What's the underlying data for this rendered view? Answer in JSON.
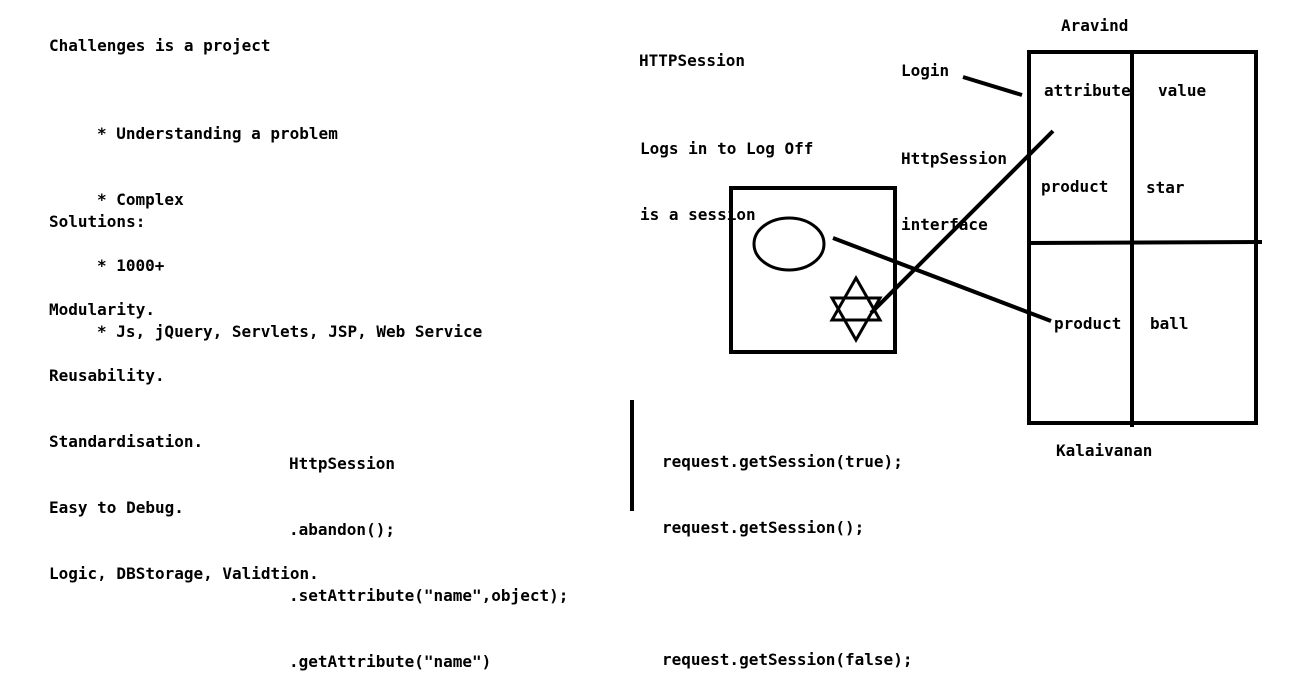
{
  "challenges": {
    "title": "Challenges is a project",
    "bullets": [
      "* Understanding a problem",
      "* Complex",
      "* 1000+",
      "* Js, jQuery, Servlets, JSP, Web Service"
    ]
  },
  "solutions": {
    "title": "Solutions:",
    "items": [
      "Modularity.",
      "Reusability.",
      "Standardisation.",
      "Easy to Debug.",
      "Logic, DBStorage, Validtion."
    ]
  },
  "http_session_heading": "HTTPSession",
  "session_note": [
    "Logs in to Log Off",
    "is a session"
  ],
  "login_label": "Login",
  "interface_label": [
    "HttpSession",
    "interface"
  ],
  "user_top": "Aravind",
  "user_bottom": "Kalaivanan",
  "session_table": {
    "header": {
      "attribute": "attribute",
      "value": "value"
    },
    "rows": [
      {
        "attribute": "product",
        "value": "star"
      },
      {
        "attribute": "product",
        "value": "ball"
      }
    ]
  },
  "methods": {
    "title": "HttpSession",
    "lines": [
      ".abandon();",
      ".setAttribute(\"name\",object);",
      ".getAttribute(\"name\")"
    ]
  },
  "request_calls": [
    "request.getSession(true);",
    "request.getSession();",
    "",
    "request.getSession(false);"
  ]
}
